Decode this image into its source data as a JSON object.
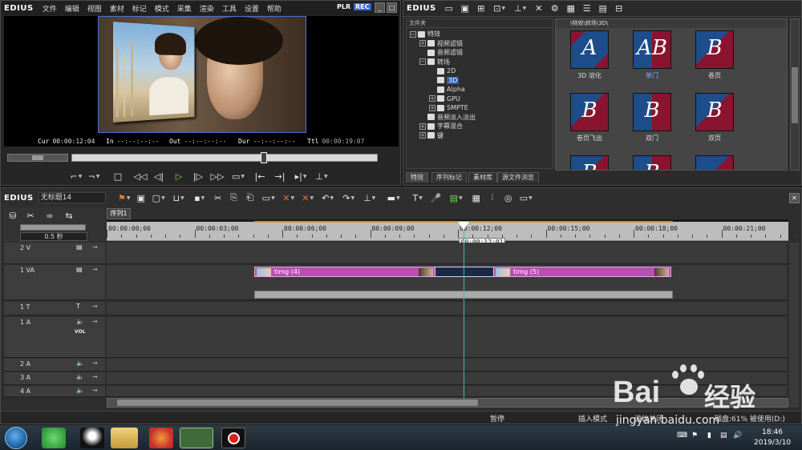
{
  "app": {
    "logo": "EDIUS",
    "menu": [
      "文件",
      "编辑",
      "视图",
      "素材",
      "标记",
      "模式",
      "采集",
      "渲染",
      "工具",
      "设置",
      "帮助"
    ],
    "plr": "PLR",
    "rec": "REC"
  },
  "player": {
    "cur_label": "Cur",
    "cur": "00:00:12:04",
    "in_label": "In",
    "in": "--:--:--:--",
    "out_label": "Out",
    "out": "--:--:--:--",
    "dur_label": "Dur",
    "dur": "--:--:--:--",
    "ttl_label": "Ttl",
    "ttl": "00:00:19:07",
    "scrub_position": 0.63
  },
  "effects": {
    "logo": "EDIUS",
    "folder_header": "文件夹",
    "path": "\\特效\\转场\\3D\\",
    "tree": [
      {
        "indent": 0,
        "box": "−",
        "label": "特效"
      },
      {
        "indent": 1,
        "box": "+",
        "label": "视频滤镜"
      },
      {
        "indent": 1,
        "box": "",
        "label": "音频滤镜"
      },
      {
        "indent": 1,
        "box": "−",
        "label": "转场"
      },
      {
        "indent": 2,
        "box": "",
        "label": "2D"
      },
      {
        "indent": 2,
        "box": "",
        "label": "3D",
        "selected": true
      },
      {
        "indent": 2,
        "box": "",
        "label": "Alpha"
      },
      {
        "indent": 2,
        "box": "+",
        "label": "GPU"
      },
      {
        "indent": 2,
        "box": "+",
        "label": "SMPTE"
      },
      {
        "indent": 1,
        "box": "",
        "label": "音频淡入淡出"
      },
      {
        "indent": 1,
        "box": "+",
        "label": "字幕混合"
      },
      {
        "indent": 1,
        "box": "+",
        "label": "键"
      }
    ],
    "thumbs": [
      {
        "label": "3D 溶化",
        "glyph": "A"
      },
      {
        "label": "单门",
        "glyph": "AB",
        "highlight": true
      },
      {
        "label": "卷页",
        "glyph": "B"
      },
      {
        "label": "卷页飞出",
        "glyph": "B"
      },
      {
        "label": "双门",
        "glyph": "B"
      },
      {
        "label": "双页",
        "glyph": "B"
      },
      {
        "label": "",
        "glyph": "B"
      },
      {
        "label": "",
        "glyph": "B"
      },
      {
        "label": "",
        "glyph": ""
      }
    ],
    "tabs": [
      "特效",
      "序列标记",
      "素材库",
      "源文件浏览"
    ]
  },
  "timeline": {
    "logo": "EDIUS",
    "project_name": "无标题14",
    "sequence_tab": "序列1",
    "scale": "0.5 秒",
    "ruler": [
      "00:00:00;00",
      "00:00:03;00",
      "00:00:06;00",
      "00:00:09;00",
      "00:00:12;00",
      "00:00:15;00",
      "00:00:18;00",
      "00:00:21;00"
    ],
    "playhead_tc": "00:00:12;01",
    "tracks": [
      {
        "name": "2 V"
      },
      {
        "name": "1 VA"
      },
      {
        "name": "1 T"
      },
      {
        "name": "1 A",
        "vol": "VOL"
      },
      {
        "name": "2 A"
      },
      {
        "name": "3 A"
      },
      {
        "name": "4 A"
      }
    ],
    "clips": [
      {
        "label": "timg (4)"
      },
      {
        "label": "timg (5)"
      }
    ]
  },
  "status": [
    "暂停",
    "插入模式",
    "波纹关闭",
    "磁盘:61% 被使用(D:)"
  ],
  "taskbar": {
    "time": "18:46",
    "date": "2019/3/10"
  },
  "watermark": {
    "brand": "Bai",
    "brand2": "经验",
    "url": "jingyan.baidu.com"
  },
  "colors": {
    "clip": "#b84fb3",
    "playhead": "#39b9c4",
    "rec": "#2a6ad8",
    "accent": "#2f5fbf"
  }
}
